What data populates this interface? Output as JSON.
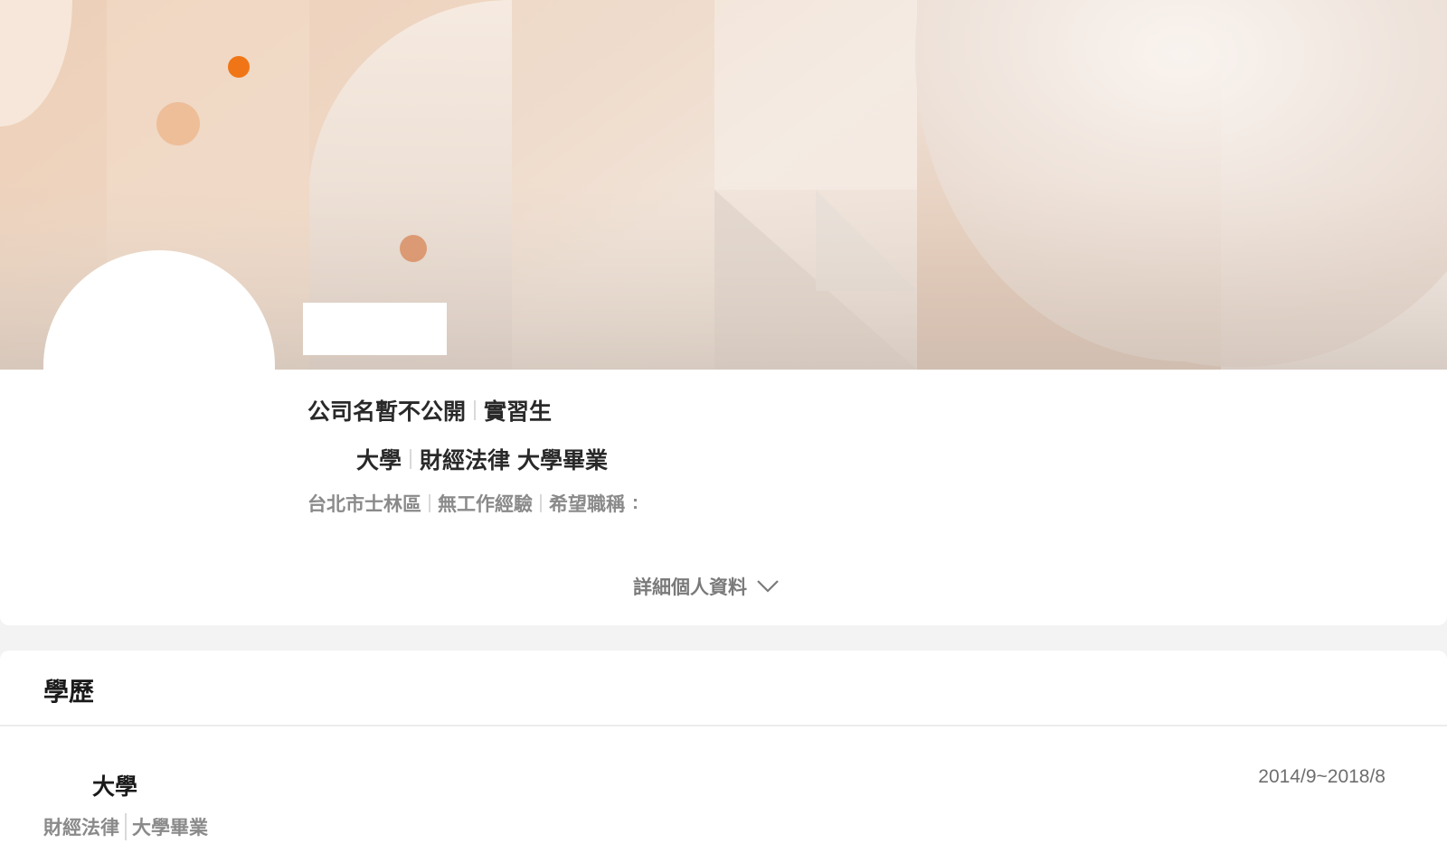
{
  "profile": {
    "line1": {
      "company": "公司名暫不公開",
      "job_title": "實習生"
    },
    "line2": {
      "school": "大學",
      "major": "財經法律",
      "degree": "大學畢業"
    },
    "line3": {
      "location": "台北市士林區",
      "experience": "無工作經驗",
      "desired_title_label": "希望職稱",
      "trailing": ":"
    },
    "details_toggle": {
      "label": "詳細個人資料",
      "icon": "chevron-down-icon"
    }
  },
  "education": {
    "section_title": "學歷",
    "entries": [
      {
        "school": "大學",
        "period": "2014/9~2018/8",
        "major": "財經法律",
        "degree": "大學畢業"
      }
    ]
  },
  "colors": {
    "banner_base": "#e6c7ad",
    "accent_orange": "#f07516",
    "dot_peach": "#edb990",
    "dot_terracotta": "#d88a5c",
    "page_background": "#f3f3f3",
    "separator": "#d9d9d9"
  }
}
